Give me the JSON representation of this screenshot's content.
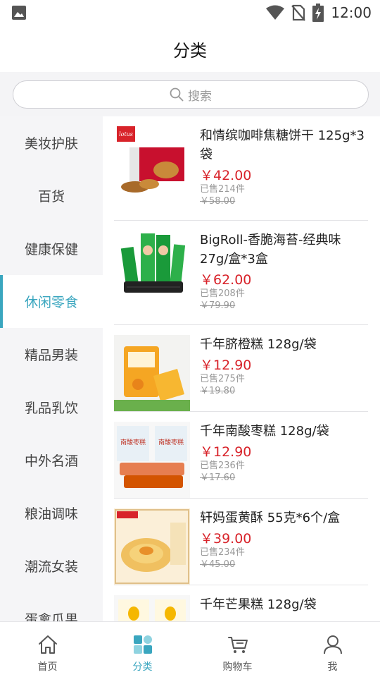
{
  "status_bar": {
    "time": "12:00"
  },
  "header": {
    "title": "分类"
  },
  "search": {
    "placeholder": "搜索"
  },
  "categories": [
    {
      "label": "美妆护肤"
    },
    {
      "label": "百货"
    },
    {
      "label": "健康保健"
    },
    {
      "label": "休闲零食",
      "active": true
    },
    {
      "label": "精品男装"
    },
    {
      "label": "乳品乳饮"
    },
    {
      "label": "中外名酒"
    },
    {
      "label": "粮油调味"
    },
    {
      "label": "潮流女装"
    },
    {
      "label": "蛋禽瓜果"
    }
  ],
  "products": [
    {
      "name": "和情缤咖啡焦糖饼干 125g*3袋",
      "price": "￥42.00",
      "sold": "已售214件",
      "original_price": "￥58.00"
    },
    {
      "name": "BigRoll-香脆海苔-经典味 27g/盒*3盒",
      "price": "￥62.00",
      "sold": "已售208件",
      "original_price": "￥79.90"
    },
    {
      "name": "千年脐橙糕 128g/袋",
      "price": "￥12.90",
      "sold": "已售275件",
      "original_price": "￥19.80"
    },
    {
      "name": "千年南酸枣糕 128g/袋",
      "price": "￥12.90",
      "sold": "已售236件",
      "original_price": "￥17.60"
    },
    {
      "name": "轩妈蛋黄酥 55克*6个/盒",
      "price": "￥39.00",
      "sold": "已售234件",
      "original_price": "￥45.00"
    },
    {
      "name": "千年芒果糕 128g/袋"
    }
  ],
  "tabs": [
    {
      "label": "首页",
      "icon": "home-icon"
    },
    {
      "label": "分类",
      "icon": "category-icon",
      "active": true
    },
    {
      "label": "购物车",
      "icon": "cart-icon"
    },
    {
      "label": "我",
      "icon": "user-icon"
    }
  ],
  "colors": {
    "accent": "#3aa6bf",
    "price": "#d8232a",
    "sidebar_bg": "#f5f5f7"
  }
}
